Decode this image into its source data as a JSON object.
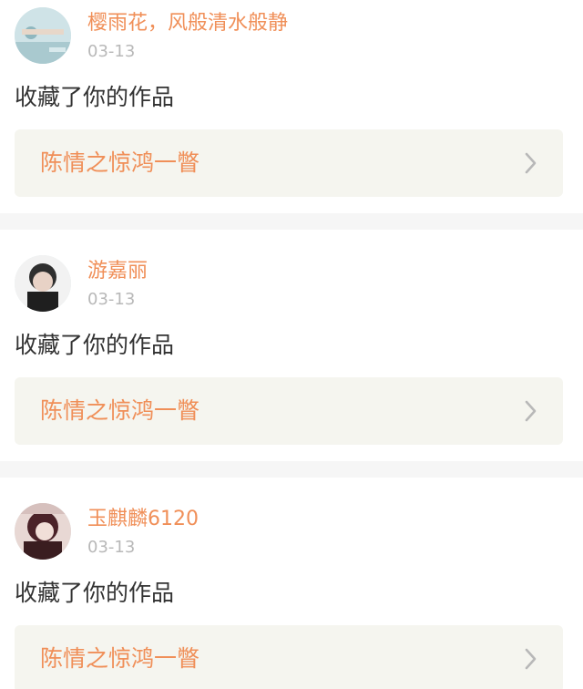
{
  "notifications": [
    {
      "username": "樱雨花，风般清水般静",
      "date": "03-13",
      "action": "收藏了你的作品",
      "work_title": "陈情之惊鸿一瞥",
      "avatar_icon": "avatar-photo-icon"
    },
    {
      "username": "游嘉丽",
      "date": "03-13",
      "action": "收藏了你的作品",
      "work_title": "陈情之惊鸿一瞥",
      "avatar_icon": "avatar-photo-icon"
    },
    {
      "username": "玉麒麟6120",
      "date": "03-13",
      "action": "收藏了你的作品",
      "work_title": "陈情之惊鸿一瞥",
      "avatar_icon": "avatar-photo-icon"
    }
  ],
  "colors": {
    "accent": "#f08f58",
    "muted": "#b8b8b8",
    "text": "#333333",
    "card_bg": "#f5f5ef",
    "separator": "#f6f6f6"
  }
}
